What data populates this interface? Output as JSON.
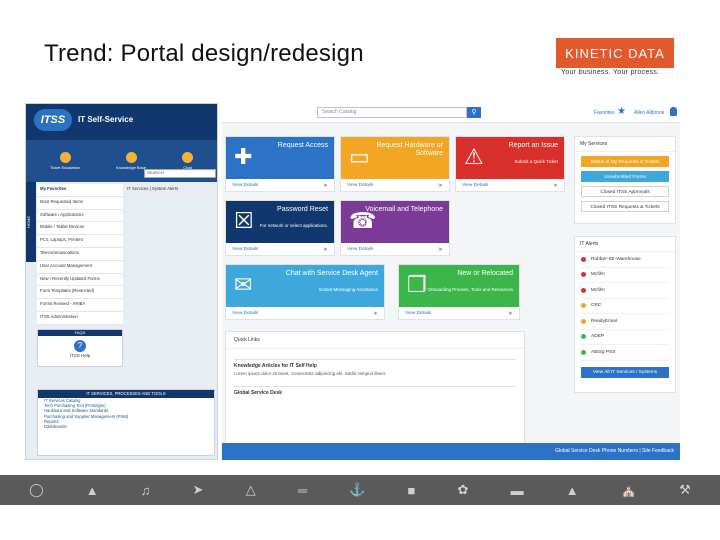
{
  "slide": {
    "title": "Trend: Portal design/redesign"
  },
  "logo": {
    "name": "KINETIC DATA",
    "tagline": "Your business. Your process."
  },
  "old_portal": {
    "logo": "ITSS",
    "title": "IT Self-Service",
    "nav": [
      "Ticket Escalation",
      "Knowledge Base",
      "Chat"
    ],
    "search_label": "SEARCH",
    "side_label": "HOME",
    "favorites_header": "My Favorites",
    "breadcrumb": "IT Services | System Alerts",
    "list": [
      "Most Requested Items",
      "Software / Applications",
      "Mobile / Tablet Devices",
      "PCs, Laptops, Printers",
      "Telecommunications",
      "User Account Management",
      "New / Recently Updated Forms",
      "Form Templates (Restricted)",
      "Forms Revised - ARIBA",
      "ITSS Administration"
    ],
    "faq": {
      "header": "FAQS",
      "icon": "?",
      "label": "ITSS Help"
    },
    "tools": {
      "header": "IT SERVICES, PROCESSES AND TOOLS",
      "items": [
        "IT Services Catalog",
        "Tech Purchasing Tool (Prototype)",
        "Hardware and Software Standards",
        "Purchasing and Supplier Management (PSM)",
        "Reports",
        "Dashboards"
      ]
    }
  },
  "new_portal": {
    "search_placeholder": "Search Catalog",
    "favorites": "Favorites",
    "user": "Allen Allbrook",
    "tiles": [
      {
        "title": "Request Access",
        "sub": "",
        "color": "#2c73c8",
        "icon": "user-plus-icon",
        "glyph": "✚",
        "link": "View Details"
      },
      {
        "title": "Request Hardware or Software",
        "sub": "",
        "color": "#f2a623",
        "icon": "monitor-icon",
        "glyph": "▭",
        "link": "View Details"
      },
      {
        "title": "Report an Issue",
        "sub": "Submit a Quick Ticket",
        "color": "#d9302c",
        "icon": "warning-icon",
        "glyph": "⚠",
        "link": "View Details"
      },
      {
        "title": "Password Reset",
        "sub": "For network or select applications.",
        "color": "#11386e",
        "icon": "lock-icon",
        "glyph": "☒",
        "link": "View Details"
      },
      {
        "title": "Voicemail and Telephone",
        "sub": "",
        "color": "#7b3a96",
        "icon": "phone-icon",
        "glyph": "☎",
        "link": "View Details"
      },
      {
        "title": "Chat with Service Desk Agent",
        "sub": "Instant Messaging Assistance",
        "color": "#3ea8dc",
        "icon": "chat-icon",
        "glyph": "✉",
        "link": "View Details"
      },
      {
        "title": "New or Relocated",
        "sub": "Onboarding Process, Tools and Resources",
        "color": "#3cb54a",
        "icon": "briefcase-icon",
        "glyph": "❒",
        "link": "View Details"
      }
    ],
    "quick_links": {
      "header": "Quick Links",
      "kb_title": "Knowledge Articles for IT Self Help",
      "kb_text": "Lorem ipsum dolor sit amet, consectetur adipiscing elit. Sedlic tempus libero.",
      "section": "Global Service Desk"
    },
    "my_services": {
      "header": "My Services",
      "items": [
        {
          "label": "Status of My Requests & Tickets",
          "bg": "#f2a623",
          "fg": "#fff"
        },
        {
          "label": "Unsubmitted Forms",
          "bg": "#3ea8dc",
          "fg": "#fff"
        },
        {
          "label": "Closed ITSS Approvals",
          "bg": "#fff",
          "fg": "#333"
        },
        {
          "label": "Closed ITSS Requests & Tickets",
          "bg": "#fff",
          "fg": "#333"
        }
      ]
    },
    "alerts": {
      "header": "IT Alerts",
      "items": [
        {
          "label": "Rubber-SE-Warehouse",
          "color": "#d9302c"
        },
        {
          "label": "Mcfilm",
          "color": "#d9302c"
        },
        {
          "label": "Mcfilm",
          "color": "#d9302c"
        },
        {
          "label": "CRC",
          "color": "#f2a623"
        },
        {
          "label": "ReadyEmail",
          "color": "#f2a623"
        },
        {
          "label": "ADEP",
          "color": "#3cb54a"
        },
        {
          "label": "ABISg PSS",
          "color": "#3cb54a"
        }
      ],
      "view_all": "View All IT Services / Systems"
    },
    "footer": "Global Service Desk Phone Numbers | Site Feedback"
  }
}
